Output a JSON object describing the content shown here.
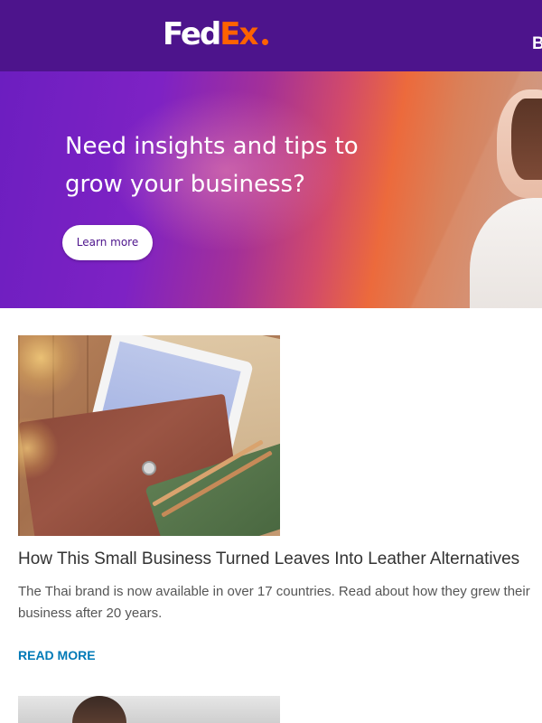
{
  "header": {
    "logo_fed": "Fed",
    "logo_ex": "Ex",
    "nav_partial": "B"
  },
  "hero": {
    "headline": "Need insights and tips to grow your business?",
    "cta_label": "Learn more"
  },
  "articles": [
    {
      "title": "How This Small Business Turned Leaves Into Leather Alternatives",
      "description": "The Thai brand is now available in over 17 countries. Read about how they grew their business after 20 years.",
      "link_label": "READ MORE"
    }
  ],
  "colors": {
    "brand_purple": "#4d148c",
    "brand_orange": "#ff6200",
    "link_blue": "#007ab7"
  }
}
